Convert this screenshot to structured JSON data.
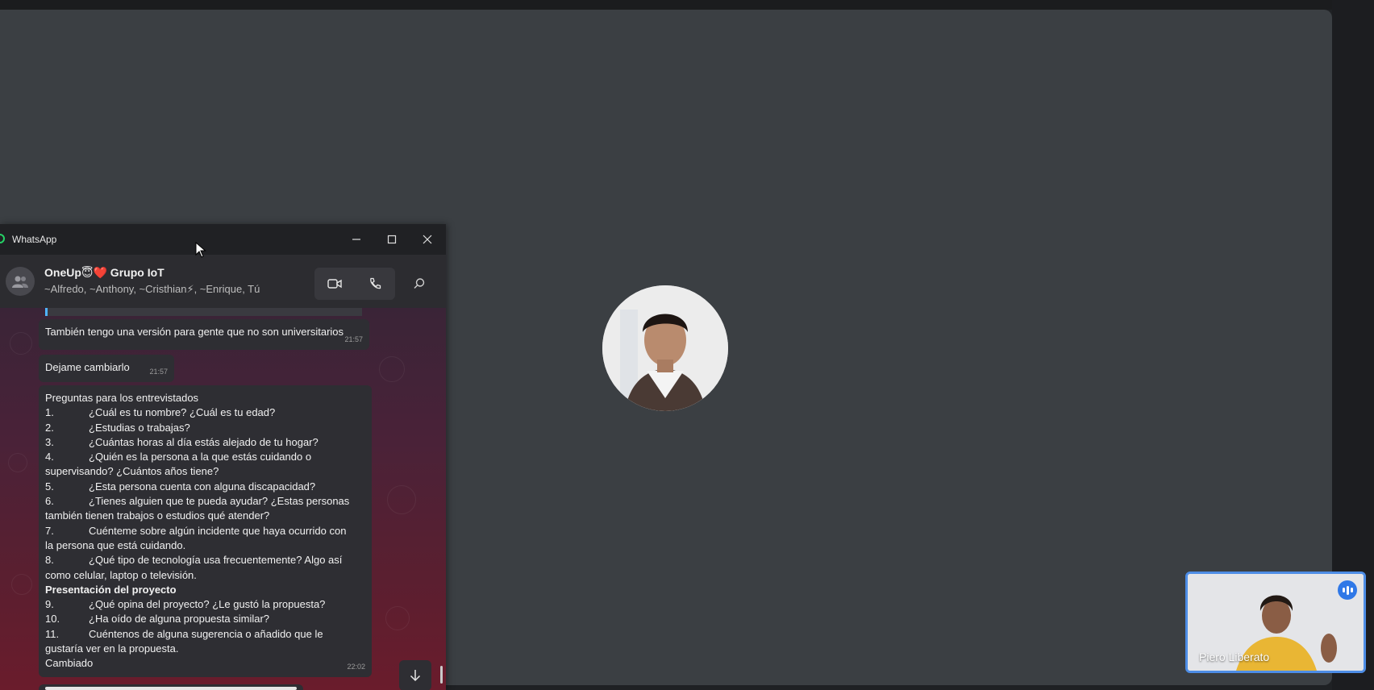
{
  "meeting": {
    "self_tile": {
      "name": "Piero Liberato"
    }
  },
  "whatsapp": {
    "app_title": "WhatsApp",
    "window_controls": {
      "minimize_icon": "minimize-icon",
      "maximize_icon": "maximize-icon",
      "close_icon": "close-icon"
    },
    "chat": {
      "title": "OneUp😇❤️ Grupo IoT",
      "members": "~Alfredo, ~Anthony, ~Cristhian⚡, ~Enrique, Tú",
      "actions": [
        "video-call-icon",
        "voice-call-icon",
        "search-icon"
      ]
    },
    "messages": [
      {
        "text": "También tengo una versión para gente que no son universitarios",
        "time": "21:57"
      },
      {
        "text": "Dejame cambiarlo",
        "time": "21:57"
      }
    ],
    "long_message": {
      "heading": "Preguntas para los entrevistados",
      "items": [
        {
          "num": "1.",
          "text": "¿Cuál es tu nombre? ¿Cuál es tu edad?"
        },
        {
          "num": "2.",
          "text": "¿Estudias o trabajas?"
        },
        {
          "num": "3.",
          "text": "¿Cuántas horas al día estás alejado de tu hogar?"
        },
        {
          "num": "4.",
          "text": "¿Quién es la persona a la que estás cuidando o",
          "cont": "supervisando? ¿Cuántos años tiene?"
        },
        {
          "num": "5.",
          "text": "¿Esta persona cuenta con alguna discapacidad?"
        },
        {
          "num": "6.",
          "text": "¿Tienes alguien que te pueda ayudar? ¿Estas personas",
          "cont": "también tienen trabajos o estudios qué atender?"
        },
        {
          "num": "7.",
          "text": "Cuénteme sobre algún incidente que haya ocurrido con",
          "cont": "la persona que está cuidando."
        },
        {
          "num": "8.",
          "text": "¿Qué tipo de tecnología usa frecuentemente? Algo así",
          "cont": "como celular, laptop o televisión."
        }
      ],
      "section_title": "Presentación del proyecto",
      "items2": [
        {
          "num": "9.",
          "text": "¿Qué opina del proyecto? ¿Le gustó la propuesta?"
        },
        {
          "num": "10.",
          "text": "¿Ha oído de alguna propuesta similar?"
        },
        {
          "num": "11.",
          "text": "Cuéntenos de alguna sugerencia o añadido que le",
          "cont": "gustaría ver en la propuesta."
        }
      ],
      "footer": "Cambiado",
      "time": "22:02"
    }
  }
}
